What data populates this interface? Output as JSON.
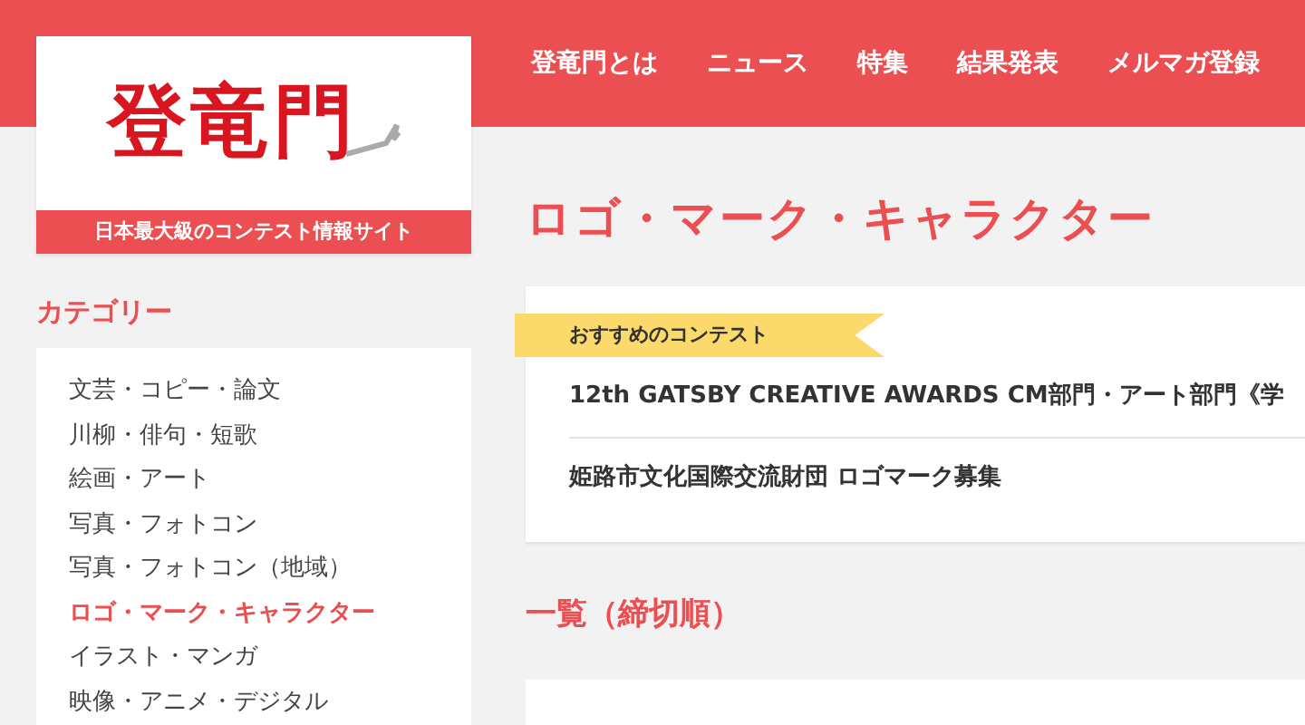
{
  "header": {
    "logo": {
      "text": "登竜門",
      "tagline": "日本最大級のコンテスト情報サイト"
    },
    "nav": [
      "登竜門とは",
      "ニュース",
      "特集",
      "結果発表",
      "メルマガ登録"
    ]
  },
  "sidebar": {
    "heading": "カテゴリー",
    "items": [
      {
        "label": "文芸・コピー・論文",
        "selected": false
      },
      {
        "label": "川柳・俳句・短歌",
        "selected": false
      },
      {
        "label": "絵画・アート",
        "selected": false
      },
      {
        "label": "写真・フォトコン",
        "selected": false
      },
      {
        "label": "写真・フォトコン（地域）",
        "selected": false
      },
      {
        "label": "ロゴ・マーク・キャラクター",
        "selected": true
      },
      {
        "label": "イラスト・マンガ",
        "selected": false
      },
      {
        "label": "映像・アニメ・デジタル",
        "selected": false
      }
    ]
  },
  "main": {
    "title": "ロゴ・マーク・キャラクター",
    "featured": {
      "ribbon": "おすすめのコンテスト",
      "items": [
        "12th GATSBY CREATIVE AWARDS CM部門・アート部門《学",
        "姫路市文化国際交流財団 ロゴマーク募集"
      ]
    },
    "list_heading": "一覧（締切順）"
  }
}
